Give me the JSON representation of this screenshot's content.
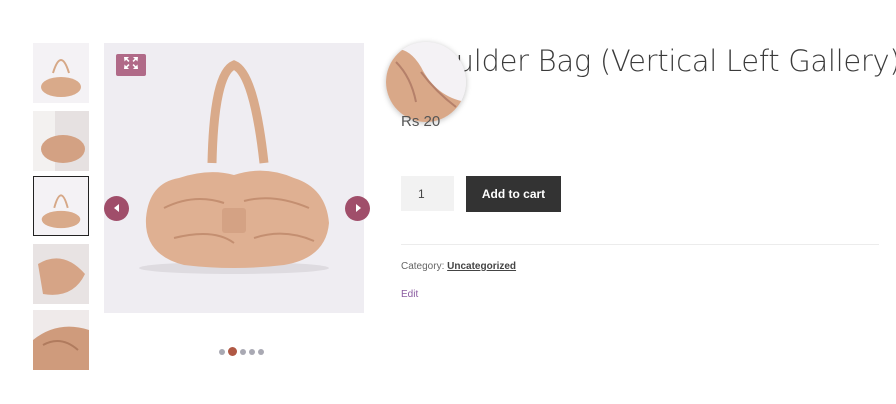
{
  "product": {
    "title": "Shoulder Bag (Vertical Left Gallery)",
    "price": "Rs 20",
    "quantity_value": "1",
    "add_to_cart_label": "Add to cart",
    "category_label": "Category:",
    "category_link": "Uncategorized",
    "edit_label": "Edit"
  },
  "gallery": {
    "thumbnails": [
      {
        "alt": "bag-front"
      },
      {
        "alt": "bag-worn"
      },
      {
        "alt": "bag-front",
        "active": true
      },
      {
        "alt": "bag-detail"
      },
      {
        "alt": "bag-closeup"
      }
    ],
    "active_slide": 2,
    "slide_count": 5
  },
  "colors": {
    "accent_button": "#a04e6a",
    "dark_button": "#333333",
    "link_purple": "#8a5ba0",
    "active_dot": "#b05844"
  },
  "icons": {
    "zoom": "expand-icon",
    "prev": "chevron-left-icon",
    "next": "chevron-right-icon"
  }
}
